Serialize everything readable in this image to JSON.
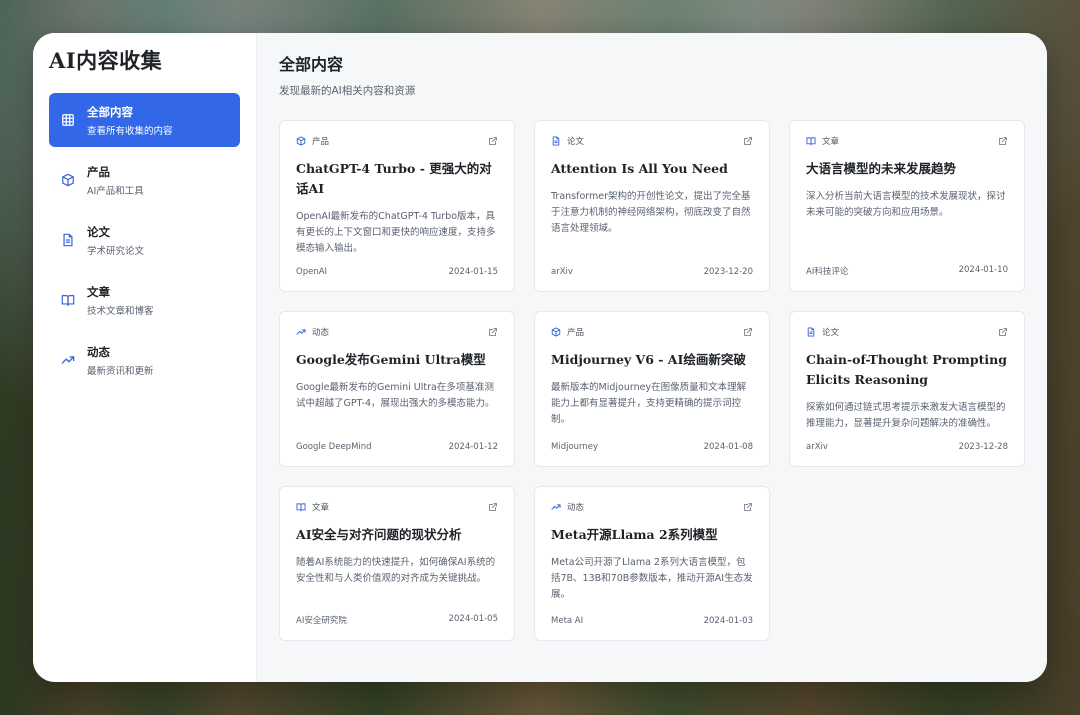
{
  "app": {
    "title": "AI内容收集"
  },
  "sidebar": {
    "items": [
      {
        "label": "全部内容",
        "sub": "查看所有收集的内容",
        "icon": "grid-icon"
      },
      {
        "label": "产品",
        "sub": "AI产品和工具",
        "icon": "cube-icon"
      },
      {
        "label": "论文",
        "sub": "学术研究论文",
        "icon": "document-icon"
      },
      {
        "label": "文章",
        "sub": "技术文章和博客",
        "icon": "book-open-icon"
      },
      {
        "label": "动态",
        "sub": "最新资讯和更新",
        "icon": "trending-up-icon"
      }
    ]
  },
  "main": {
    "title": "全部内容",
    "subtitle": "发现最新的AI相关内容和资源",
    "cards": [
      {
        "category": "产品",
        "cat_icon": "cube-icon",
        "title": "ChatGPT-4 Turbo - 更强大的对话AI",
        "desc": "OpenAI最新发布的ChatGPT-4 Turbo版本，具有更长的上下文窗口和更快的响应速度，支持多模态输入输出。",
        "source": "OpenAI",
        "date": "2024-01-15"
      },
      {
        "category": "论文",
        "cat_icon": "document-icon",
        "title": "Attention Is All You Need",
        "desc": "Transformer架构的开创性论文，提出了完全基于注意力机制的神经网络架构，彻底改变了自然语言处理领域。",
        "source": "arXiv",
        "date": "2023-12-20"
      },
      {
        "category": "文章",
        "cat_icon": "book-open-icon",
        "title": "大语言模型的未来发展趋势",
        "desc": "深入分析当前大语言模型的技术发展现状，探讨未来可能的突破方向和应用场景。",
        "source": "AI科技评论",
        "date": "2024-01-10"
      },
      {
        "category": "动态",
        "cat_icon": "trending-up-icon",
        "title": "Google发布Gemini Ultra模型",
        "desc": "Google最新发布的Gemini Ultra在多项基准测试中超越了GPT-4，展现出强大的多模态能力。",
        "source": "Google DeepMind",
        "date": "2024-01-12"
      },
      {
        "category": "产品",
        "cat_icon": "cube-icon",
        "title": "Midjourney V6 - AI绘画新突破",
        "desc": "最新版本的Midjourney在图像质量和文本理解能力上都有显著提升，支持更精确的提示词控制。",
        "source": "Midjourney",
        "date": "2024-01-08"
      },
      {
        "category": "论文",
        "cat_icon": "document-icon",
        "title": "Chain-of-Thought Prompting Elicits Reasoning",
        "desc": "探索如何通过链式思考提示来激发大语言模型的推理能力，显著提升复杂问题解决的准确性。",
        "source": "arXiv",
        "date": "2023-12-28"
      },
      {
        "category": "文章",
        "cat_icon": "book-open-icon",
        "title": "AI安全与对齐问题的现状分析",
        "desc": "随着AI系统能力的快速提升，如何确保AI系统的安全性和与人类价值观的对齐成为关键挑战。",
        "source": "AI安全研究院",
        "date": "2024-01-05"
      },
      {
        "category": "动态",
        "cat_icon": "trending-up-icon",
        "title": "Meta开源Llama 2系列模型",
        "desc": "Meta公司开源了Llama 2系列大语言模型，包括7B、13B和70B参数版本，推动开源AI生态发展。",
        "source": "Meta AI",
        "date": "2024-01-03"
      }
    ]
  },
  "colors": {
    "accent": "#3268e8",
    "icon": "#3a66d9"
  }
}
